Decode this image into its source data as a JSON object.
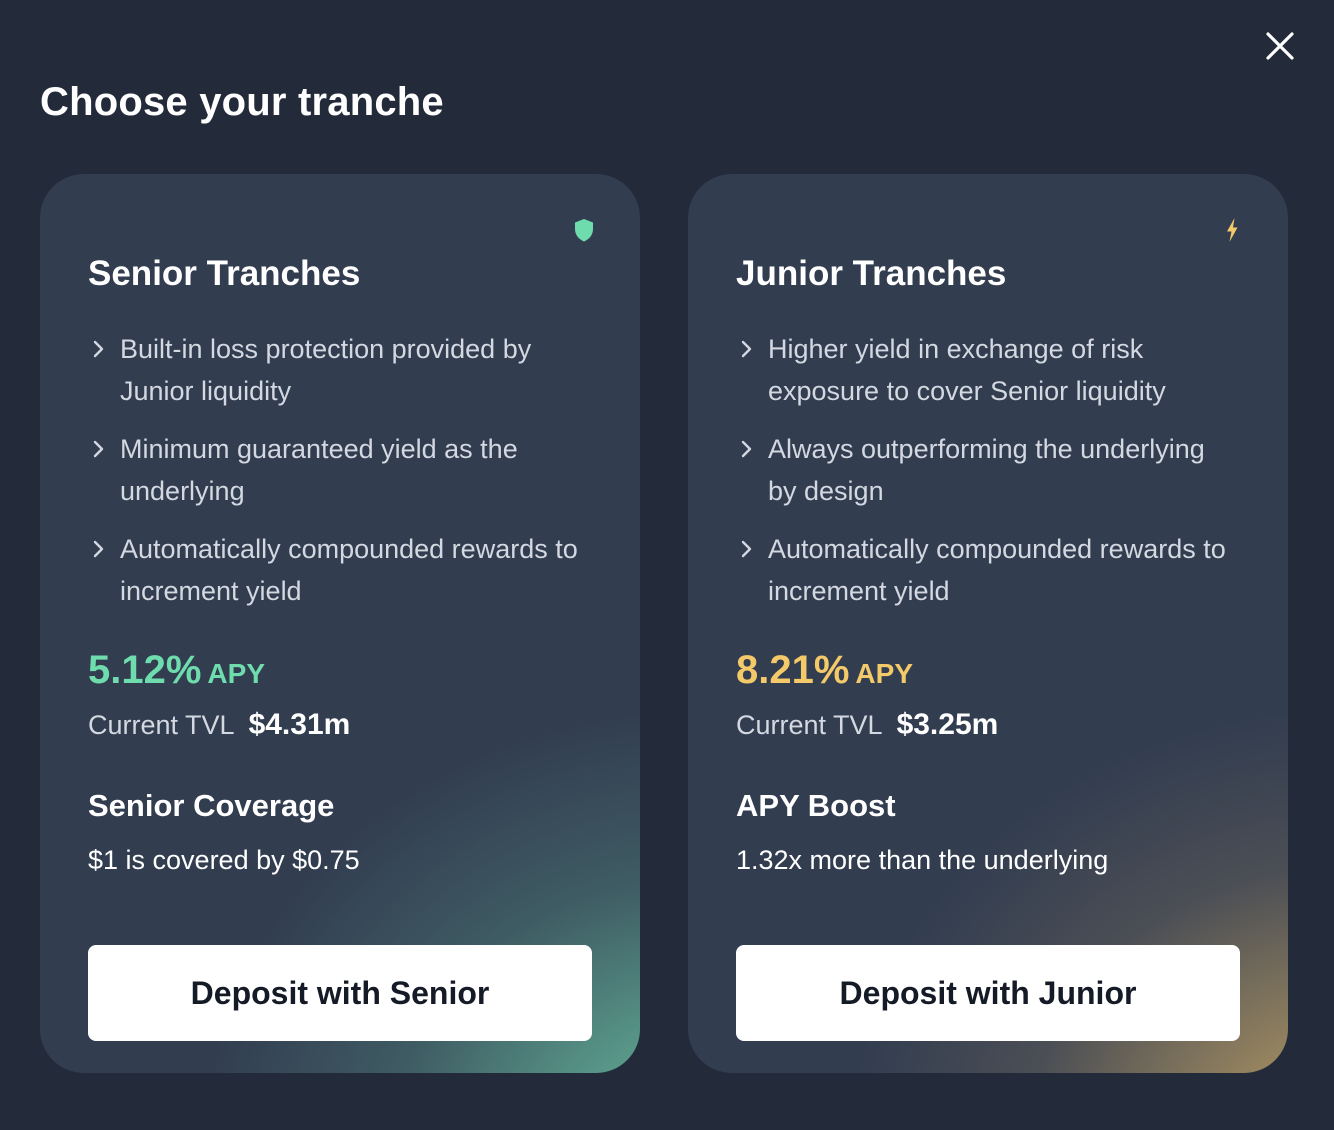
{
  "modal": {
    "title": "Choose your tranche",
    "close_icon": "close-icon"
  },
  "cards": [
    {
      "id": "senior",
      "icon": "shield-icon",
      "accent_color": "#6fdcae",
      "title": "Senior Tranches",
      "features": [
        "Built-in loss protection provided by Junior liquidity",
        "Minimum guaranteed yield as the underlying",
        "Automatically compounded rewards to increment yield"
      ],
      "apy_value": "5.12%",
      "apy_unit": "APY",
      "tvl_label": "Current TVL",
      "tvl_value": "$4.31m",
      "section_title": "Senior Coverage",
      "section_desc": "$1 is covered by $0.75",
      "button_label": "Deposit with Senior"
    },
    {
      "id": "junior",
      "icon": "lightning-icon",
      "accent_color": "#f3c969",
      "title": "Junior Tranches",
      "features": [
        "Higher yield in exchange of risk exposure to cover Senior liquidity",
        "Always outperforming the underlying by design",
        "Automatically compounded rewards to increment yield"
      ],
      "apy_value": "8.21%",
      "apy_unit": "APY",
      "tvl_label": "Current TVL",
      "tvl_value": "$3.25m",
      "section_title": "APY Boost",
      "section_desc": "1.32x more than the underlying",
      "button_label": "Deposit with Junior"
    }
  ]
}
